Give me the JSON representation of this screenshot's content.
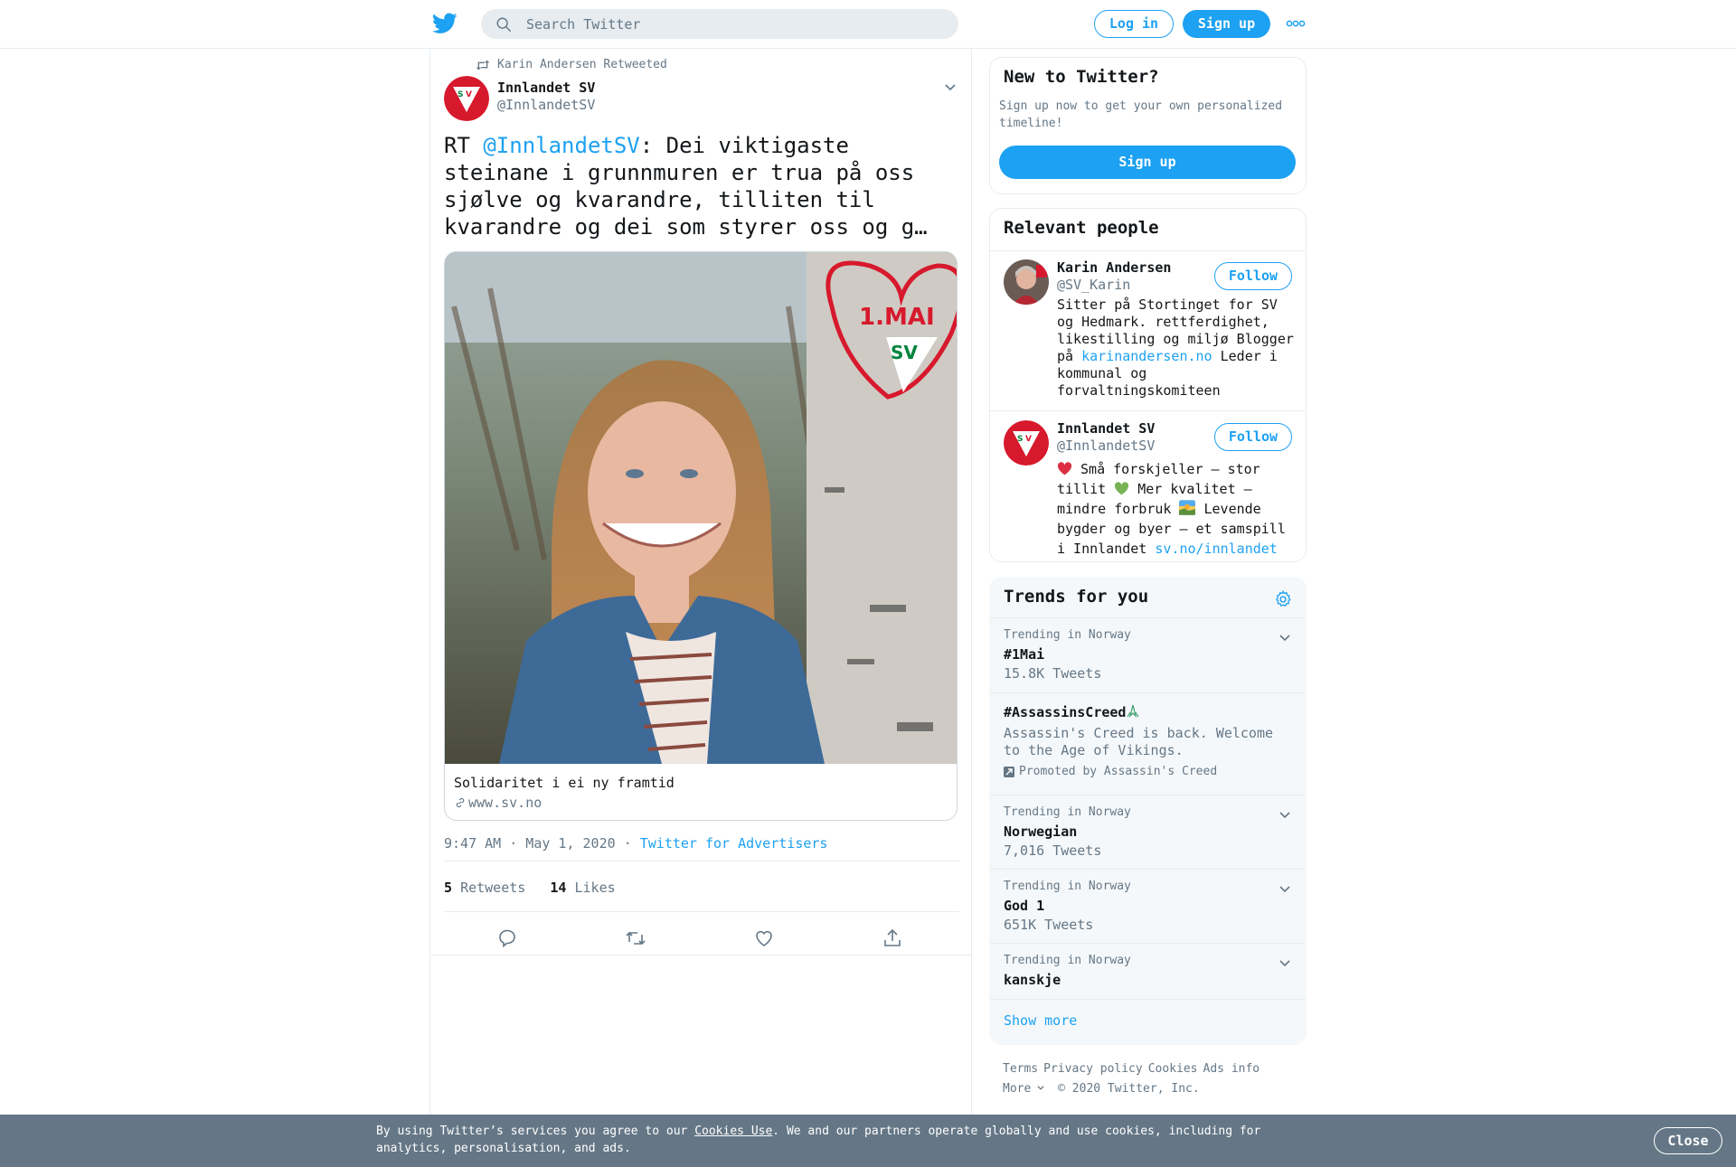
{
  "header": {
    "search_placeholder": "Search Twitter",
    "login_label": "Log in",
    "signup_label": "Sign up",
    "brand_color": "#1da1f2"
  },
  "tweet": {
    "retweeted_by": "Karin Andersen Retweeted",
    "author_name": "Innlandet SV",
    "author_handle": "@InnlandetSV",
    "text_prefix": "RT ",
    "mention": "@InnlandetSV",
    "text_rest": ": Dei viktigaste steinane i grunnmuren er trua på oss sjølve og kvarandre, tilliten til kvarandre og dei som styrer oss og g…",
    "card": {
      "image_overlay_text": "1.MAI",
      "image_logo_text": "SV",
      "title": "Solidaritet i ei ny framtid",
      "domain": "www.sv.no"
    },
    "timestamp": "9:47 AM · May 1, 2020",
    "separator": "·",
    "via": "Twitter for Advertisers",
    "retweets_count": "5",
    "retweets_label": "Retweets",
    "likes_count": "14",
    "likes_label": "Likes",
    "actions": [
      "reply-icon",
      "retweet-icon",
      "like-icon",
      "share-icon"
    ]
  },
  "sidebar": {
    "new_to_twitter": {
      "title": "New to Twitter?",
      "text": "Sign up now to get your own personalized timeline!",
      "button": "Sign up"
    },
    "relevant_people": {
      "title": "Relevant people",
      "people": [
        {
          "name": "Karin Andersen",
          "handle": "@SV_Karin",
          "follow": "Follow",
          "bio_text": "Sitter på Stortinget for SV og Hedmark. rettferdighet, likestilling og miljø Blogger på ",
          "bio_link": "karinandersen.no",
          "bio_text2": " Leder i kommunal og forvaltningskomiteen"
        },
        {
          "name": "Innlandet SV",
          "handle": "@InnlandetSV",
          "follow": "Follow",
          "bio_a": " Små forskjeller – stor tillit ",
          "bio_b": " Mer kvalitet – mindre forbruk ",
          "bio_c": " Levende bygder og byer – et samspill i Innlandet ",
          "bio_link": "sv.no/innlandet"
        }
      ]
    },
    "trends": {
      "title": "Trends for you",
      "items": [
        {
          "context": "Trending in Norway",
          "name": "#1Mai",
          "count": "15.8K Tweets"
        },
        {
          "name": "#AssassinsCreed",
          "description": "Assassin's Creed is back. Welcome to the Age of Vikings.",
          "promoted": "Promoted by Assassin's Creed"
        },
        {
          "context": "Trending in Norway",
          "name": "Norwegian",
          "count": "7,016 Tweets"
        },
        {
          "context": "Trending in Norway",
          "name": "God 1",
          "count": "651K Tweets"
        },
        {
          "context": "Trending in Norway",
          "name": "kanskje"
        }
      ],
      "show_more": "Show more"
    },
    "footer": {
      "links": [
        "Terms",
        "Privacy policy",
        "Cookies",
        "Ads info"
      ],
      "more": "More",
      "copyright": "© 2020 Twitter, Inc."
    }
  },
  "cookie_bar": {
    "text_before": "By using Twitter’s services you agree to our ",
    "link": "Cookies Use",
    "text_after": ". We and our partners operate globally and use cookies, including for analytics, personalisation, and ads.",
    "close": "Close"
  }
}
